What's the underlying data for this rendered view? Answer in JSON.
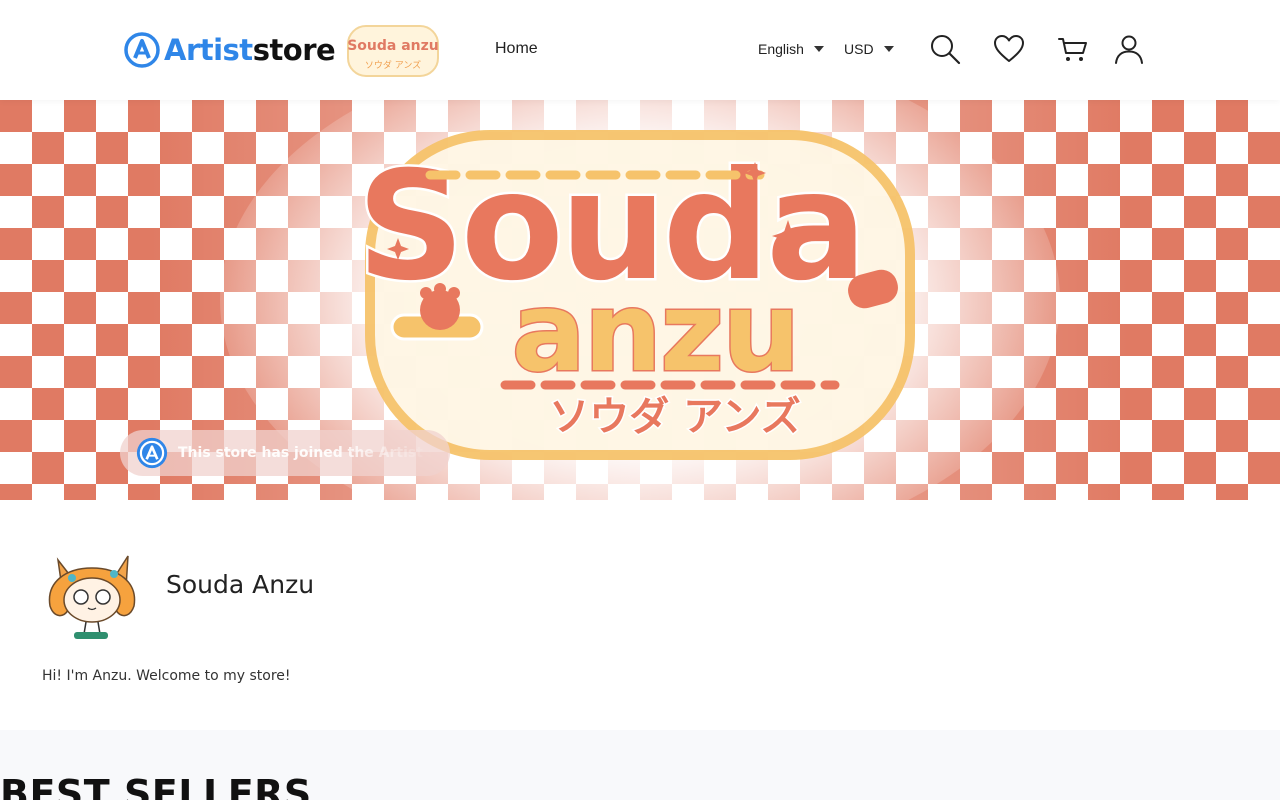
{
  "header": {
    "logo_text_a": "Artist",
    "logo_text_b": "store",
    "store_logo_text": "Souda anzu",
    "nav": {
      "home_label": "Home"
    },
    "language": "English",
    "currency": "USD",
    "icons": [
      "search-icon",
      "heart-icon",
      "cart-icon",
      "user-icon"
    ]
  },
  "banner": {
    "logo_line1": "Souda",
    "logo_line2": "anzu",
    "logo_katakana": "ソウダ アンズ",
    "joined_text": "This store has joined the Artist store"
  },
  "profile": {
    "name": "Souda Anzu",
    "bio": "Hi! I'm Anzu. Welcome to my store!"
  },
  "sections": {
    "best_sellers": "BEST SELLERS"
  },
  "colors": {
    "accent": "#2f86e8",
    "checker": "#e07a63",
    "logo_orange": "#e8785e",
    "logo_yellow": "#f6c36b"
  }
}
